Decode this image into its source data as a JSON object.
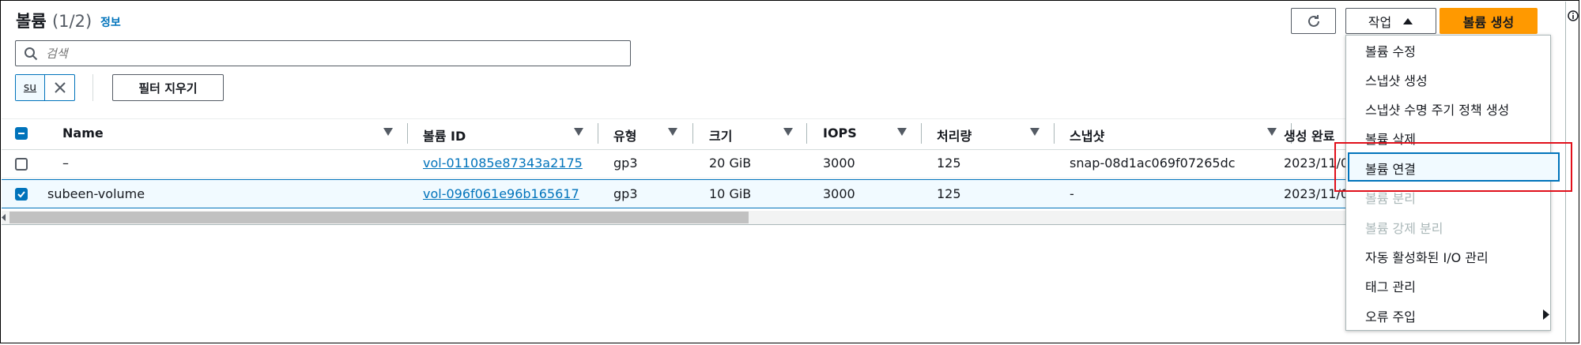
{
  "header": {
    "title": "볼륨",
    "count": "(1/2)",
    "info_link": "정보",
    "actions_label": "작업",
    "create_label": "볼륨 생성"
  },
  "search": {
    "placeholder": "검색"
  },
  "filter_token": {
    "label": "su"
  },
  "clear_filters_label": "필터 지우기",
  "columns": [
    "Name",
    "볼륨 ID",
    "유형",
    "크기",
    "IOPS",
    "처리량",
    "스냅샷",
    "생성 완료"
  ],
  "rows": [
    {
      "name": "–",
      "volume_id": "vol-011085e87343a2175",
      "type": "gp3",
      "size": "20 GiB",
      "iops": "3000",
      "throughput": "125",
      "snapshot": "snap-08d1ac069f07265dc",
      "created": "2023/11/0",
      "selected": false
    },
    {
      "name": "subeen-volume",
      "volume_id": "vol-096f061e96b165617",
      "type": "gp3",
      "size": "10 GiB",
      "iops": "3000",
      "throughput": "125",
      "snapshot": "-",
      "created": "2023/11/0",
      "selected": true
    }
  ],
  "menu": {
    "items": [
      {
        "label": "볼륨 수정",
        "disabled": false
      },
      {
        "label": "스냅샷 생성",
        "disabled": false
      },
      {
        "label": "스냅샷 수명 주기 정책 생성",
        "disabled": false
      },
      {
        "label": "볼륨 삭제",
        "disabled": false
      },
      {
        "label": "볼륨 연결",
        "disabled": false
      },
      {
        "label": "볼륨 분리",
        "disabled": true
      },
      {
        "label": "볼륨 강제 분리",
        "disabled": true
      },
      {
        "label": "자동 활성화된 I/O 관리",
        "disabled": false
      },
      {
        "label": "태그 관리",
        "disabled": false
      },
      {
        "label": "오류 주입",
        "disabled": false
      }
    ]
  },
  "colors": {
    "accent": "#0073bb",
    "primary_button": "#ff9900",
    "highlight": "#e0101b"
  }
}
